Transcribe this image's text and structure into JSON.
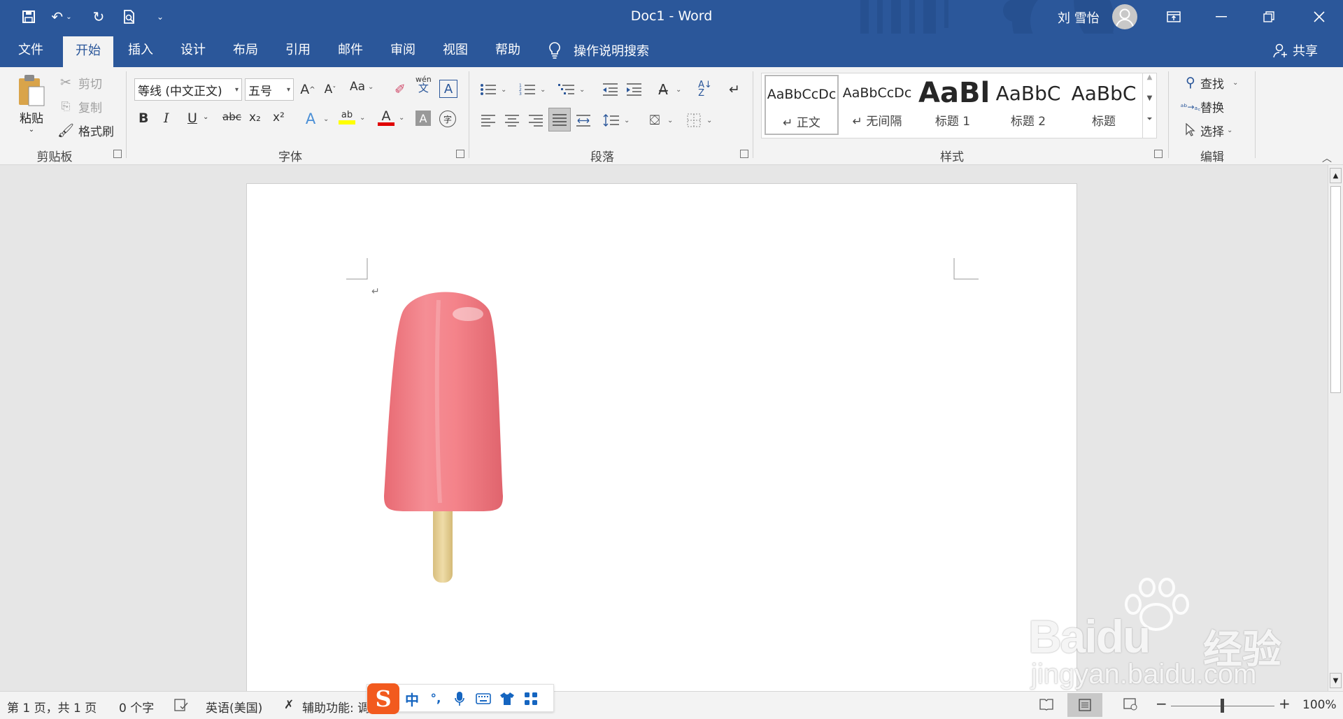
{
  "window": {
    "title": "Doc1 - Word",
    "user": "刘 雪怡"
  },
  "tabs": [
    "文件",
    "开始",
    "插入",
    "设计",
    "布局",
    "引用",
    "邮件",
    "审阅",
    "视图",
    "帮助"
  ],
  "tell_me": "操作说明搜索",
  "share": "共享",
  "clipboard": {
    "paste": "粘贴",
    "cut": "剪切",
    "copy": "复制",
    "format_painter": "格式刷",
    "group": "剪贴板"
  },
  "font": {
    "name": "等线 (中文正文)",
    "size": "五号",
    "group": "字体",
    "aa": "Aa",
    "phonetic": "wén",
    "phonetic_char": "文",
    "bold": "B",
    "italic": "I",
    "underline": "U",
    "strike": "abc",
    "sub": "x₂",
    "sup": "x²",
    "enclose": "字"
  },
  "paragraph": {
    "group": "段落"
  },
  "styles": {
    "group": "样式",
    "items": [
      {
        "preview": "AaBbCcDc",
        "name": "↵ 正文"
      },
      {
        "preview": "AaBbCcDc",
        "name": "↵ 无间隔"
      },
      {
        "preview": "AaBl",
        "name": "标题 1"
      },
      {
        "preview": "AaBbC",
        "name": "标题 2"
      },
      {
        "preview": "AaBbC",
        "name": "标题"
      }
    ]
  },
  "editing": {
    "find": "查找",
    "replace": "替换",
    "select": "选择",
    "group": "编辑"
  },
  "status": {
    "page": "第 1 页，共 1 页",
    "words": "0 个字",
    "language": "英语(美国)",
    "accessibility": "辅助功能: 调",
    "zoom": "100%"
  },
  "ime": {
    "zh": "中",
    "punct": "°,"
  },
  "watermark": {
    "brand": "Baidu",
    "cn": "经验",
    "url": "jingyan.baidu.com"
  },
  "colors": {
    "brand": "#2b579a",
    "highlight": "#ffff00",
    "font_color": "#e00000",
    "popsicle": "#f07f86",
    "stick": "#e8d39a"
  }
}
